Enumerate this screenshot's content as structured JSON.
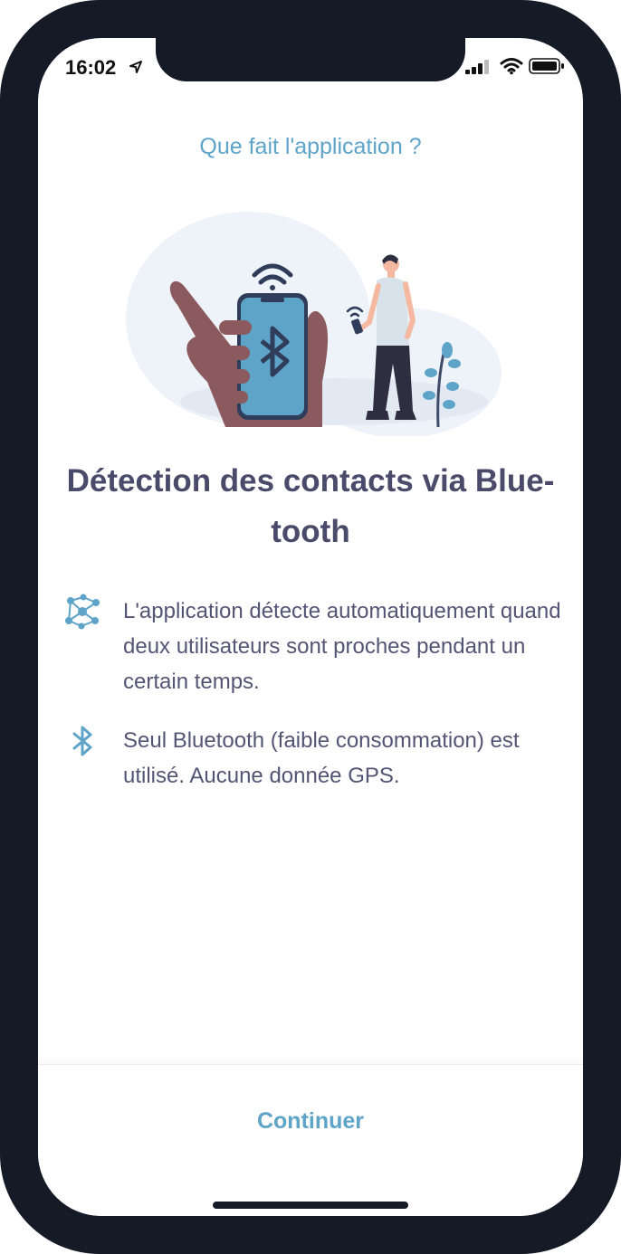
{
  "status_bar": {
    "time": "16:02",
    "icons": [
      "location-arrow-icon",
      "cellular-signal-icon",
      "wifi-icon",
      "battery-icon"
    ]
  },
  "header": {
    "question": "Que fait l'application ?"
  },
  "illustration": {
    "icon": "person-phone-bluetooth-illustration"
  },
  "title": "Détection des contacts via Blue-tooth",
  "features": [
    {
      "icon": "network-nodes-icon",
      "text": "L'application détecte automatiquement quand deux utilisateurs sont proches pendant un certain temps."
    },
    {
      "icon": "bluetooth-icon",
      "text": "Seul Bluetooth (faible consommation) est utilisé. Aucune donnée GPS."
    }
  ],
  "footer": {
    "continue_label": "Continuer"
  },
  "colors": {
    "accent": "#5ea4c9",
    "title": "#4a4a6a",
    "body_text": "#535574",
    "frame": "#141a26"
  }
}
